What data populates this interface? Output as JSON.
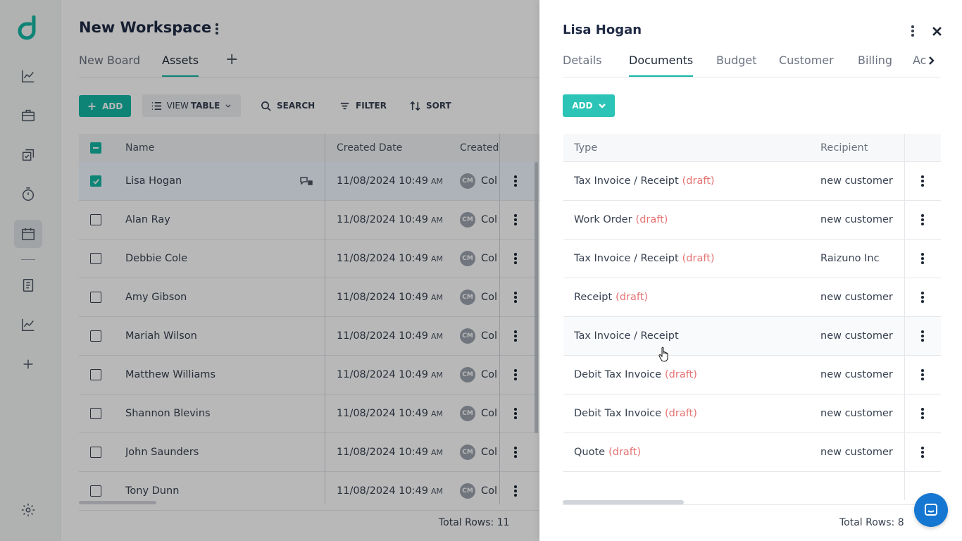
{
  "workspace": {
    "title": "New Workspace",
    "tabs": [
      {
        "label": "New Board"
      },
      {
        "label": "Assets"
      }
    ],
    "add_tab_symbol": "+"
  },
  "toolbar": {
    "add_label": "ADD",
    "view_prefix": "VIEW",
    "view_mode": "TABLE",
    "search_label": "SEARCH",
    "filter_label": "FILTER",
    "sort_label": "SORT"
  },
  "table": {
    "columns": [
      "Name",
      "Created Date",
      "Created"
    ],
    "rows": [
      {
        "name": "Lisa Hogan",
        "date": "11/08/2024 10:49",
        "ampm": "AM",
        "initials": "CM",
        "created": "Col",
        "checked": true
      },
      {
        "name": "Alan Ray",
        "date": "11/08/2024 10:49",
        "ampm": "AM",
        "initials": "CM",
        "created": "Col"
      },
      {
        "name": "Debbie Cole",
        "date": "11/08/2024 10:49",
        "ampm": "AM",
        "initials": "CM",
        "created": "Col"
      },
      {
        "name": "Amy Gibson",
        "date": "11/08/2024 10:49",
        "ampm": "AM",
        "initials": "CM",
        "created": "Col"
      },
      {
        "name": "Mariah Wilson",
        "date": "11/08/2024 10:49",
        "ampm": "AM",
        "initials": "CM",
        "created": "Col"
      },
      {
        "name": "Matthew Williams",
        "date": "11/08/2024 10:49",
        "ampm": "AM",
        "initials": "CM",
        "created": "Col"
      },
      {
        "name": "Shannon Blevins",
        "date": "11/08/2024 10:49",
        "ampm": "AM",
        "initials": "CM",
        "created": "Col"
      },
      {
        "name": "John Saunders",
        "date": "11/08/2024 10:49",
        "ampm": "AM",
        "initials": "CM",
        "created": "Col"
      },
      {
        "name": "Tony Dunn",
        "date": "11/08/2024 10:49",
        "ampm": "AM",
        "initials": "CM",
        "created": "Col"
      }
    ],
    "total": "Total Rows: 11"
  },
  "drawer": {
    "title": "Lisa Hogan",
    "tabs": [
      {
        "label": "Details"
      },
      {
        "label": "Documents"
      },
      {
        "label": "Budget"
      },
      {
        "label": "Customer"
      },
      {
        "label": "Billing"
      },
      {
        "label": "Ac"
      }
    ],
    "active_tab": "Documents",
    "add_label": "ADD",
    "columns": [
      "Type",
      "Recipient"
    ],
    "rows": [
      {
        "type": "Tax Invoice / Receipt",
        "status": "(draft)",
        "recipient": "new customer"
      },
      {
        "type": "Work Order",
        "status": "(draft)",
        "recipient": "new customer"
      },
      {
        "type": "Tax Invoice / Receipt",
        "status": "(draft)",
        "recipient": "Raizuno Inc"
      },
      {
        "type": "Receipt",
        "status": "(draft)",
        "recipient": "new customer"
      },
      {
        "type": "Tax Invoice / Receipt",
        "status": "",
        "recipient": "new customer"
      },
      {
        "type": "Debit Tax Invoice",
        "status": "(draft)",
        "recipient": "new customer"
      },
      {
        "type": "Debit Tax Invoice",
        "status": "(draft)",
        "recipient": "new customer"
      },
      {
        "type": "Quote",
        "status": "(draft)",
        "recipient": "new customer"
      }
    ],
    "total": "Total Rows: 8"
  },
  "icons": {
    "nav": [
      "chart-line-icon",
      "briefcase-icon",
      "checklist-icon",
      "timer-icon",
      "calendar-icon",
      "document-icon",
      "chart-line-icon",
      "plus-icon",
      "gear-icon"
    ],
    "chat": "chat-icon"
  },
  "colors": {
    "accent": "#14b8a6",
    "draft": "#e57373",
    "chat": "#1677d2"
  }
}
